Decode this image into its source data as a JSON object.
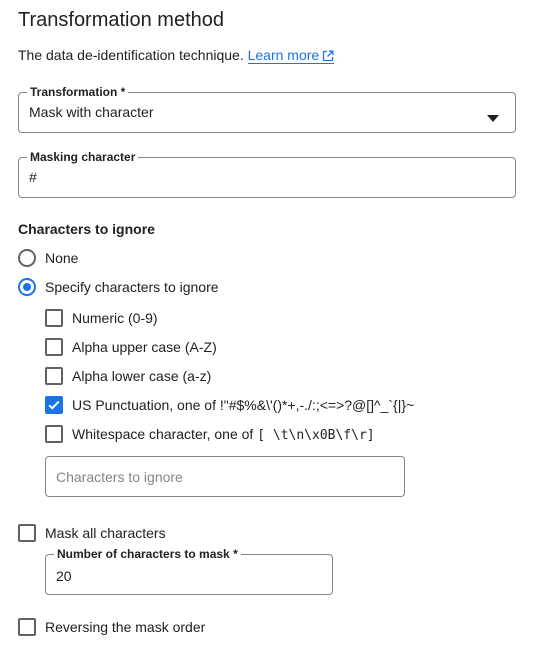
{
  "header": {
    "title": "Transformation method",
    "description": "The data de-identification technique.",
    "learn_more": "Learn more"
  },
  "transformation": {
    "label": "Transformation *",
    "value": "Mask with character"
  },
  "masking_character": {
    "label": "Masking character",
    "value": "#"
  },
  "ignore": {
    "heading": "Characters to ignore",
    "radio_none": "None",
    "radio_specify": "Specify characters to ignore",
    "selected": "specify",
    "options": [
      {
        "label": "Numeric (0-9)",
        "checked": false
      },
      {
        "label": "Alpha upper case (A-Z)",
        "checked": false
      },
      {
        "label": "Alpha lower case (a-z)",
        "checked": false
      },
      {
        "label": "US Punctuation, one of !\"#$%&\\'()*+,-./:;<=>?@[]^_`{|}~",
        "checked": true
      },
      {
        "label_prefix": "Whitespace character, one of",
        "label_code": "[ \\t\\n\\x0B\\f\\r]",
        "checked": false
      }
    ],
    "input_placeholder": "Characters to ignore"
  },
  "mask_all": {
    "label": "Mask all characters",
    "checked": false
  },
  "num_to_mask": {
    "label": "Number of characters to mask *",
    "value": "20"
  },
  "reverse": {
    "label": "Reversing the mask order",
    "checked": false
  },
  "colors": {
    "accent": "#1a73e8",
    "border": "#80868b",
    "text": "#202124"
  }
}
